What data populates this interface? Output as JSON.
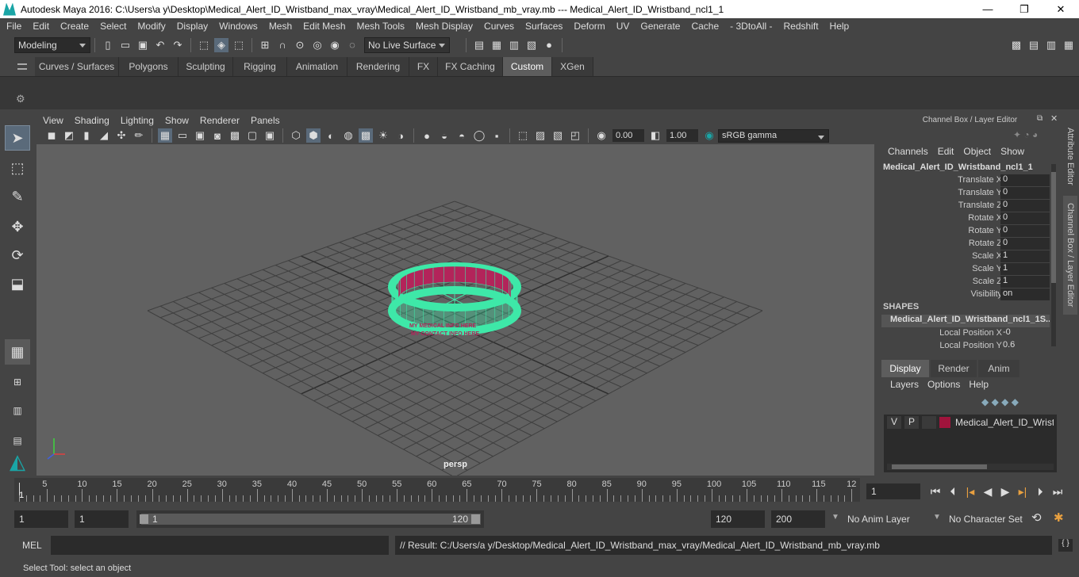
{
  "window": {
    "title": "Autodesk Maya 2016: C:\\Users\\a y\\Desktop\\Medical_Alert_ID_Wristband_max_vray\\Medical_Alert_ID_Wristband_mb_vray.mb   ---   Medical_Alert_ID_Wristband_ncl1_1",
    "minimize": "—",
    "maximize": "❐",
    "close": "✕"
  },
  "menubar": [
    "File",
    "Edit",
    "Create",
    "Select",
    "Modify",
    "Display",
    "Windows",
    "Mesh",
    "Edit Mesh",
    "Mesh Tools",
    "Mesh Display",
    "Curves",
    "Surfaces",
    "Deform",
    "UV",
    "Generate",
    "Cache",
    "- 3DtoAll -",
    "Redshift",
    "Help"
  ],
  "status": {
    "mode": "Modeling",
    "live_surface": "No Live Surface"
  },
  "shelf_tabs": [
    {
      "label": "Curves / Surfaces",
      "active": false
    },
    {
      "label": "Polygons",
      "active": false
    },
    {
      "label": "Sculpting",
      "active": false
    },
    {
      "label": "Rigging",
      "active": false
    },
    {
      "label": "Animation",
      "active": false
    },
    {
      "label": "Rendering",
      "active": false
    },
    {
      "label": "FX",
      "active": false
    },
    {
      "label": "FX Caching",
      "active": false
    },
    {
      "label": "Custom",
      "active": true
    },
    {
      "label": "XGen",
      "active": false
    }
  ],
  "viewport": {
    "menu": [
      "View",
      "Shading",
      "Lighting",
      "Show",
      "Renderer",
      "Panels"
    ],
    "exposure": "0.00",
    "gamma": "1.00",
    "color_space": "sRGB gamma",
    "camera": "persp",
    "band_text_1": "MY MEDICAL INFO HERE",
    "band_text_2": "MY CONTACT INFO HERE"
  },
  "channel_box": {
    "header": "Channel Box / Layer Editor",
    "menu": [
      "Channels",
      "Edit",
      "Object",
      "Show"
    ],
    "object": "Medical_Alert_ID_Wristband_ncl1_1",
    "attributes": [
      {
        "name": "Translate X",
        "value": "0"
      },
      {
        "name": "Translate Y",
        "value": "0"
      },
      {
        "name": "Translate Z",
        "value": "0"
      },
      {
        "name": "Rotate X",
        "value": "0"
      },
      {
        "name": "Rotate Y",
        "value": "0"
      },
      {
        "name": "Rotate Z",
        "value": "0"
      },
      {
        "name": "Scale X",
        "value": "1"
      },
      {
        "name": "Scale Y",
        "value": "1"
      },
      {
        "name": "Scale Z",
        "value": "1"
      },
      {
        "name": "Visibility",
        "value": "on"
      }
    ],
    "shapes_label": "SHAPES",
    "shape_name": "Medical_Alert_ID_Wristband_ncl1_1S...",
    "shape_attributes": [
      {
        "name": "Local Position X",
        "value": "-0"
      },
      {
        "name": "Local Position Y",
        "value": "0.6"
      }
    ]
  },
  "layer_editor": {
    "tabs": [
      {
        "label": "Display",
        "active": true
      },
      {
        "label": "Render",
        "active": false
      },
      {
        "label": "Anim",
        "active": false
      }
    ],
    "menu": [
      "Layers",
      "Options",
      "Help"
    ],
    "layer": {
      "v": "V",
      "p": "P",
      "name": "Medical_Alert_ID_Wristba",
      "color": "#a0143c"
    }
  },
  "side_tabs": [
    "Attribute Editor",
    "Channel Box / Layer Editor"
  ],
  "timeline": {
    "ticks": [
      "5",
      "10",
      "15",
      "20",
      "25",
      "30",
      "35",
      "40",
      "45",
      "50",
      "55",
      "60",
      "65",
      "70",
      "75",
      "80",
      "85",
      "90",
      "95",
      "100",
      "105",
      "110",
      "115",
      "12"
    ],
    "first": "1",
    "current_frame": "1"
  },
  "range": {
    "start": "1",
    "playback_start": "1",
    "slider_start": "1",
    "slider_end": "120",
    "playback_end": "120",
    "end": "200",
    "anim_layer": "No Anim Layer",
    "character_set": "No Character Set"
  },
  "mel": {
    "label": "MEL",
    "result": "// Result: C:/Users/a y/Desktop/Medical_Alert_ID_Wristband_max_vray/Medical_Alert_ID_Wristband_mb_vray.mb"
  },
  "help_line": "Select Tool: select an object"
}
